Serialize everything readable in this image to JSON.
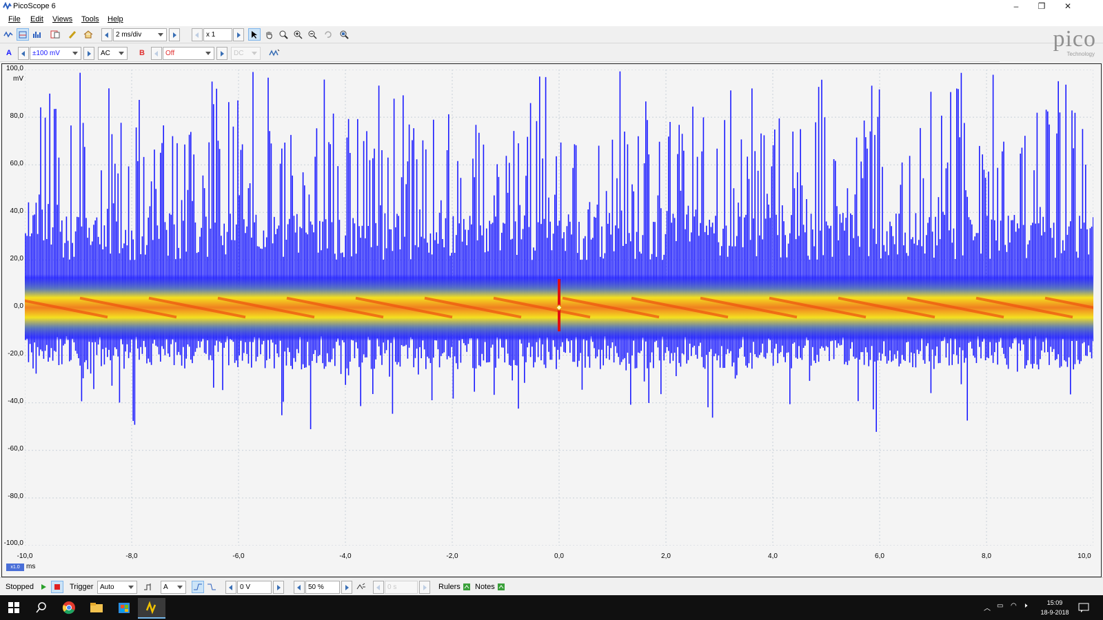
{
  "window": {
    "title": "PicoScope 6",
    "controls": [
      "–",
      "❐",
      "✕"
    ]
  },
  "menu": [
    "File",
    "Edit",
    "Views",
    "Tools",
    "Help"
  ],
  "toolbar1": {
    "timebase": "2 ms/div",
    "zoom_factor": "x 1"
  },
  "toolbar2": {
    "channel_a": "A",
    "range_a": "±100 mV",
    "coupling_a": "AC",
    "channel_b": "B",
    "range_b": "Off",
    "coupling_b": "DC"
  },
  "logo": {
    "word": "pico",
    "sub": "Technology"
  },
  "scope": {
    "y_ticks": [
      "100,0",
      "80,0",
      "60,0",
      "40,0",
      "20,0",
      "0,0",
      "-20,0",
      "-40,0",
      "-60,0",
      "-80,0",
      "-100,0"
    ],
    "y_unit": "mV",
    "x_ticks": [
      "-10,0",
      "-8,0",
      "-6,0",
      "-4,0",
      "-2,0",
      "0,0",
      "2,0",
      "4,0",
      "6,0",
      "8,0",
      "10,0"
    ],
    "x_unit": "ms",
    "x_scale_badge": "x1.0"
  },
  "chart_data": {
    "type": "line",
    "xlabel": "ms",
    "ylabel": "mV",
    "xlim": [
      -10,
      10
    ],
    "ylim": [
      -100,
      100
    ],
    "grid": true,
    "series": [
      {
        "name": "A",
        "color": "#1a1aff"
      }
    ]
  },
  "status": {
    "state": "Stopped",
    "trigger_label": "Trigger",
    "trigger_mode": "Auto",
    "trigger_channel": "A",
    "threshold": "0 V",
    "pretrigger": "50 %",
    "delay": "0 s",
    "rulers": "Rulers",
    "notes": "Notes"
  },
  "taskbar": {
    "time": "15:09",
    "date": "18-9-2018"
  }
}
